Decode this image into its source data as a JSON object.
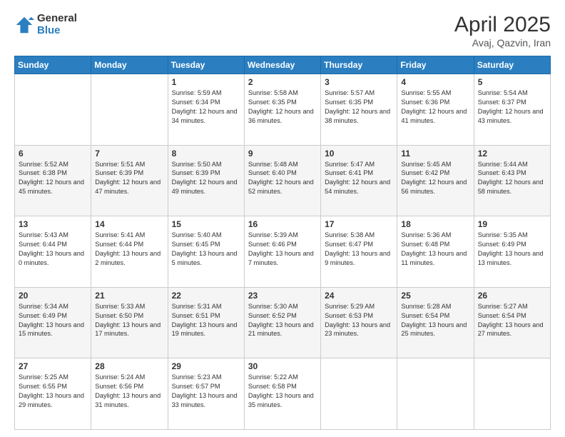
{
  "header": {
    "logo_general": "General",
    "logo_blue": "Blue",
    "title": "April 2025",
    "subtitle": "Avaj, Qazvin, Iran"
  },
  "days_of_week": [
    "Sunday",
    "Monday",
    "Tuesday",
    "Wednesday",
    "Thursday",
    "Friday",
    "Saturday"
  ],
  "weeks": [
    [
      {
        "day": "",
        "info": ""
      },
      {
        "day": "",
        "info": ""
      },
      {
        "day": "1",
        "info": "Sunrise: 5:59 AM\nSunset: 6:34 PM\nDaylight: 12 hours and 34 minutes."
      },
      {
        "day": "2",
        "info": "Sunrise: 5:58 AM\nSunset: 6:35 PM\nDaylight: 12 hours and 36 minutes."
      },
      {
        "day": "3",
        "info": "Sunrise: 5:57 AM\nSunset: 6:35 PM\nDaylight: 12 hours and 38 minutes."
      },
      {
        "day": "4",
        "info": "Sunrise: 5:55 AM\nSunset: 6:36 PM\nDaylight: 12 hours and 41 minutes."
      },
      {
        "day": "5",
        "info": "Sunrise: 5:54 AM\nSunset: 6:37 PM\nDaylight: 12 hours and 43 minutes."
      }
    ],
    [
      {
        "day": "6",
        "info": "Sunrise: 5:52 AM\nSunset: 6:38 PM\nDaylight: 12 hours and 45 minutes."
      },
      {
        "day": "7",
        "info": "Sunrise: 5:51 AM\nSunset: 6:39 PM\nDaylight: 12 hours and 47 minutes."
      },
      {
        "day": "8",
        "info": "Sunrise: 5:50 AM\nSunset: 6:39 PM\nDaylight: 12 hours and 49 minutes."
      },
      {
        "day": "9",
        "info": "Sunrise: 5:48 AM\nSunset: 6:40 PM\nDaylight: 12 hours and 52 minutes."
      },
      {
        "day": "10",
        "info": "Sunrise: 5:47 AM\nSunset: 6:41 PM\nDaylight: 12 hours and 54 minutes."
      },
      {
        "day": "11",
        "info": "Sunrise: 5:45 AM\nSunset: 6:42 PM\nDaylight: 12 hours and 56 minutes."
      },
      {
        "day": "12",
        "info": "Sunrise: 5:44 AM\nSunset: 6:43 PM\nDaylight: 12 hours and 58 minutes."
      }
    ],
    [
      {
        "day": "13",
        "info": "Sunrise: 5:43 AM\nSunset: 6:44 PM\nDaylight: 13 hours and 0 minutes."
      },
      {
        "day": "14",
        "info": "Sunrise: 5:41 AM\nSunset: 6:44 PM\nDaylight: 13 hours and 2 minutes."
      },
      {
        "day": "15",
        "info": "Sunrise: 5:40 AM\nSunset: 6:45 PM\nDaylight: 13 hours and 5 minutes."
      },
      {
        "day": "16",
        "info": "Sunrise: 5:39 AM\nSunset: 6:46 PM\nDaylight: 13 hours and 7 minutes."
      },
      {
        "day": "17",
        "info": "Sunrise: 5:38 AM\nSunset: 6:47 PM\nDaylight: 13 hours and 9 minutes."
      },
      {
        "day": "18",
        "info": "Sunrise: 5:36 AM\nSunset: 6:48 PM\nDaylight: 13 hours and 11 minutes."
      },
      {
        "day": "19",
        "info": "Sunrise: 5:35 AM\nSunset: 6:49 PM\nDaylight: 13 hours and 13 minutes."
      }
    ],
    [
      {
        "day": "20",
        "info": "Sunrise: 5:34 AM\nSunset: 6:49 PM\nDaylight: 13 hours and 15 minutes."
      },
      {
        "day": "21",
        "info": "Sunrise: 5:33 AM\nSunset: 6:50 PM\nDaylight: 13 hours and 17 minutes."
      },
      {
        "day": "22",
        "info": "Sunrise: 5:31 AM\nSunset: 6:51 PM\nDaylight: 13 hours and 19 minutes."
      },
      {
        "day": "23",
        "info": "Sunrise: 5:30 AM\nSunset: 6:52 PM\nDaylight: 13 hours and 21 minutes."
      },
      {
        "day": "24",
        "info": "Sunrise: 5:29 AM\nSunset: 6:53 PM\nDaylight: 13 hours and 23 minutes."
      },
      {
        "day": "25",
        "info": "Sunrise: 5:28 AM\nSunset: 6:54 PM\nDaylight: 13 hours and 25 minutes."
      },
      {
        "day": "26",
        "info": "Sunrise: 5:27 AM\nSunset: 6:54 PM\nDaylight: 13 hours and 27 minutes."
      }
    ],
    [
      {
        "day": "27",
        "info": "Sunrise: 5:25 AM\nSunset: 6:55 PM\nDaylight: 13 hours and 29 minutes."
      },
      {
        "day": "28",
        "info": "Sunrise: 5:24 AM\nSunset: 6:56 PM\nDaylight: 13 hours and 31 minutes."
      },
      {
        "day": "29",
        "info": "Sunrise: 5:23 AM\nSunset: 6:57 PM\nDaylight: 13 hours and 33 minutes."
      },
      {
        "day": "30",
        "info": "Sunrise: 5:22 AM\nSunset: 6:58 PM\nDaylight: 13 hours and 35 minutes."
      },
      {
        "day": "",
        "info": ""
      },
      {
        "day": "",
        "info": ""
      },
      {
        "day": "",
        "info": ""
      }
    ]
  ]
}
